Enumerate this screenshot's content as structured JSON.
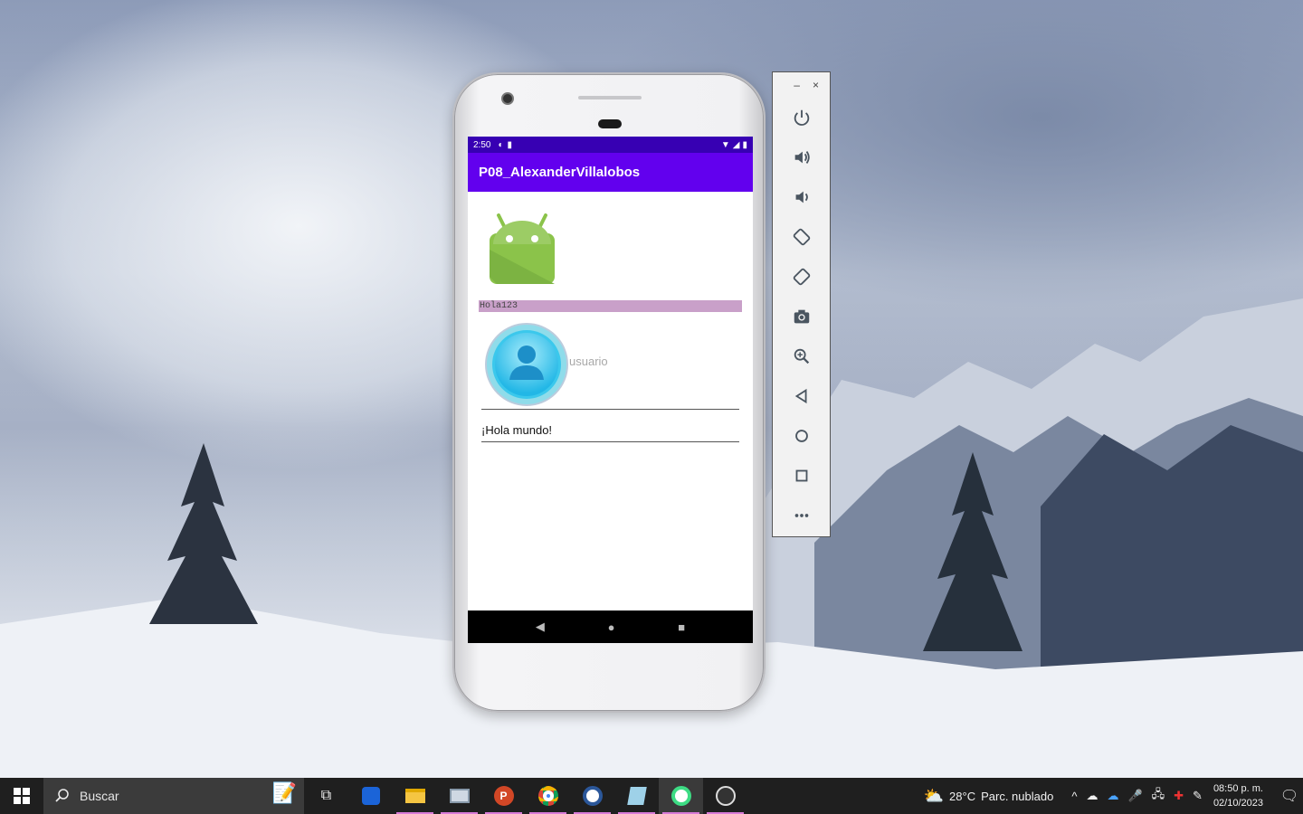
{
  "phone": {
    "status_time": "2:50",
    "app_title": "P08_AlexanderVillalobos",
    "password_text": "Hola123",
    "user_placeholder": "usuario",
    "greeting_text": "¡Hola mundo!",
    "nav": {
      "back": "◀",
      "home": "●",
      "recents": "■"
    }
  },
  "emulator": {
    "minimize": "–",
    "close": "×",
    "controls": [
      "power-icon",
      "volume-up-icon",
      "volume-down-icon",
      "rotate-left-icon",
      "rotate-right-icon",
      "camera-icon",
      "zoom-icon",
      "back-icon",
      "home-icon",
      "overview-icon",
      "more-icon"
    ]
  },
  "taskbar": {
    "search_label": "Buscar",
    "weather_temp": "28°C",
    "weather_desc": "Parc. nublado",
    "time": "08:50 p. m.",
    "date": "02/10/2023"
  },
  "colors": {
    "status_bar": "#3700b3",
    "app_bar": "#6200ee",
    "highlight_bar": "#c9a0c9",
    "taskbar": "#1f1f1f"
  }
}
